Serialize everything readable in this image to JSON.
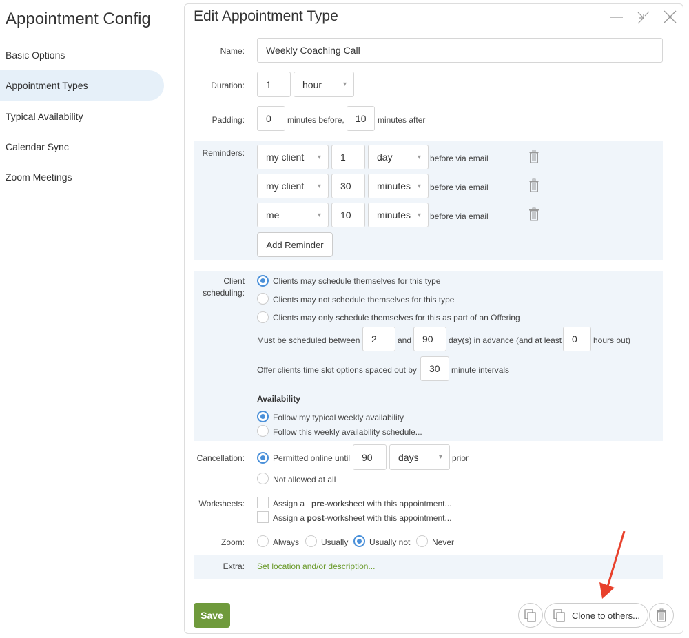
{
  "sidebar": {
    "title": "Appointment Config",
    "items": [
      {
        "label": "Basic Options"
      },
      {
        "label": "Appointment Types",
        "active": true
      },
      {
        "label": "Typical Availability"
      },
      {
        "label": "Calendar Sync"
      },
      {
        "label": "Zoom Meetings"
      }
    ]
  },
  "dialog": {
    "title": "Edit Appointment Type",
    "name": {
      "label": "Name:",
      "value": "Weekly Coaching Call"
    },
    "duration": {
      "label": "Duration:",
      "value": "1",
      "unit": "hour"
    },
    "padding": {
      "label": "Padding:",
      "before": "0",
      "before_text": "minutes before,",
      "after": "10",
      "after_text": "minutes after"
    },
    "reminders": {
      "label": "Reminders:",
      "suffix": "before via email",
      "rows": [
        {
          "who": "my client",
          "amount": "1",
          "unit": "day"
        },
        {
          "who": "my client",
          "amount": "30",
          "unit": "minutes"
        },
        {
          "who": "me",
          "amount": "10",
          "unit": "minutes"
        }
      ],
      "add_label": "Add Reminder"
    },
    "client_scheduling": {
      "label1": "Client",
      "label2": "scheduling:",
      "options": [
        "Clients may schedule themselves for this type",
        "Clients may not schedule themselves for this type",
        "Clients may only schedule themselves for this as part of an Offering"
      ],
      "selected": 0,
      "between_text": "Must be scheduled between",
      "min_days": "2",
      "and_text": "and",
      "max_days": "90",
      "advance_text": "day(s) in advance (and at least",
      "hours": "0",
      "hours_text": "hours out)",
      "spacing_text": "Offer clients time slot options spaced out by",
      "spacing": "30",
      "spacing_suffix": "minute intervals",
      "availability_heading": "Availability",
      "availability_options": [
        "Follow my typical weekly availability",
        "Follow this weekly availability schedule..."
      ],
      "availability_selected": 0
    },
    "cancellation": {
      "label": "Cancellation:",
      "permitted_text": "Permitted online until",
      "amount": "90",
      "unit": "days",
      "suffix": "prior",
      "not_allowed_text": "Not allowed at all",
      "selected": 0
    },
    "worksheets": {
      "label": "Worksheets:",
      "pre_a": "Assign a",
      "pre_b": "pre",
      "pre_c": "-worksheet with this appointment...",
      "post_a": "Assign a",
      "post_b": "post",
      "post_c": "-worksheet with this appointment..."
    },
    "zoom": {
      "label": "Zoom:",
      "options": [
        "Always",
        "Usually",
        "Usually not",
        "Never"
      ],
      "selected": 2
    },
    "extra": {
      "label": "Extra:",
      "link": "Set location and/or description..."
    },
    "footer": {
      "save": "Save",
      "clone": "Clone to others..."
    }
  },
  "colors": {
    "accent": "#4a90d9",
    "save": "#6f9a3c",
    "link": "#6a9a2a",
    "band": "#f0f5fa",
    "arrow": "#e8412c"
  }
}
